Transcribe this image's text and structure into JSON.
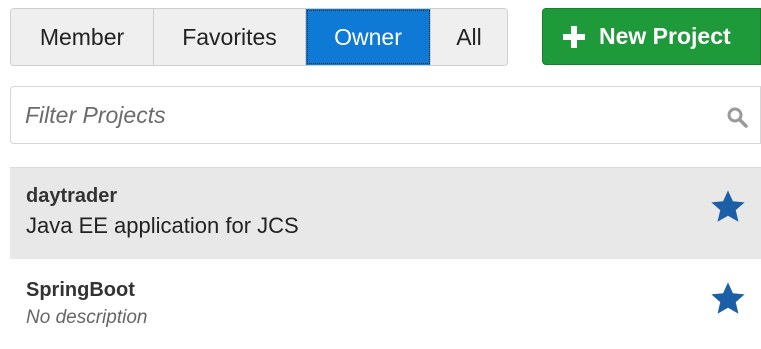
{
  "tabs": [
    {
      "label": "Member",
      "active": false
    },
    {
      "label": "Favorites",
      "active": false
    },
    {
      "label": "Owner",
      "active": true
    },
    {
      "label": "All",
      "active": false
    }
  ],
  "new_project": {
    "label": "New Project",
    "icon": "plus-icon"
  },
  "filter": {
    "placeholder": "Filter Projects",
    "value": "",
    "icon": "search-icon"
  },
  "projects": [
    {
      "name": "daytrader",
      "description": "Java EE application for JCS",
      "favorite": true,
      "highlighted": true
    },
    {
      "name": "SpringBoot",
      "description": "No description",
      "favorite": true,
      "highlighted": false
    }
  ],
  "colors": {
    "accent": "#0e7ad6",
    "new_button": "#1f9a3a",
    "star": "#1c5fa6",
    "selected_row": "#e8e8e8"
  }
}
